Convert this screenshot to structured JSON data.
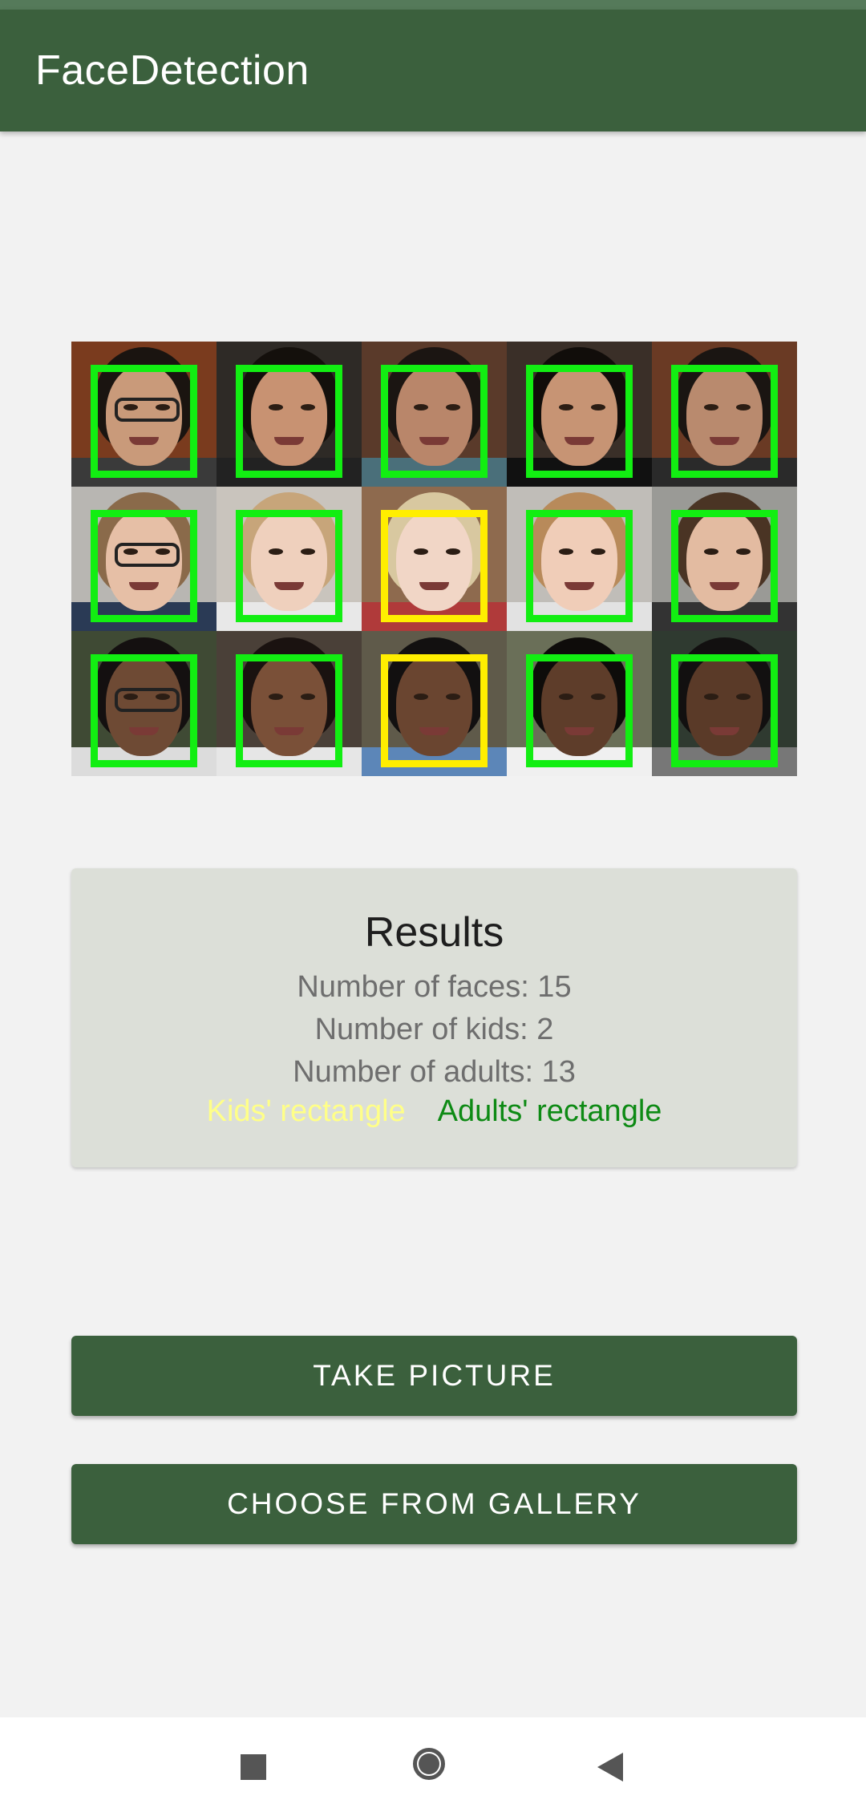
{
  "app": {
    "title": "FaceDetection"
  },
  "photo": {
    "faces": [
      {
        "group": "adult"
      },
      {
        "group": "adult"
      },
      {
        "group": "adult"
      },
      {
        "group": "adult"
      },
      {
        "group": "adult"
      },
      {
        "group": "adult"
      },
      {
        "group": "adult"
      },
      {
        "group": "kid"
      },
      {
        "group": "adult"
      },
      {
        "group": "adult"
      },
      {
        "group": "adult"
      },
      {
        "group": "adult"
      },
      {
        "group": "kid"
      },
      {
        "group": "adult"
      },
      {
        "group": "adult"
      }
    ],
    "kid_box_color": "#ffee00",
    "adult_box_color": "#12ee12"
  },
  "results": {
    "title": "Results",
    "faces_line": "Number of faces: 15",
    "kids_line": "Number of kids: 2",
    "adults_line": "Number of adults: 13",
    "legend_kids": "Kids' rectangle",
    "legend_adults": "Adults' rectangle"
  },
  "buttons": {
    "take_picture": "TAKE PICTURE",
    "choose_gallery": "CHOOSE FROM GALLERY"
  },
  "navbar": {
    "icons": [
      "recents-icon",
      "home-icon",
      "back-icon"
    ]
  },
  "colors": {
    "primary": "#3b603d",
    "card": "#dcdfd8",
    "kids_legend": "#ffff88",
    "adults_legend": "#0d8a14"
  }
}
